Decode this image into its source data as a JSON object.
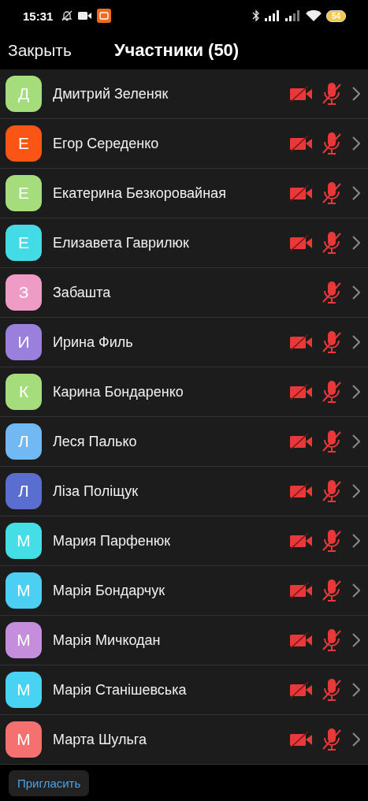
{
  "status_bar": {
    "time": "15:31",
    "battery": "54"
  },
  "header": {
    "close": "Закрыть",
    "title": "Участники (50)"
  },
  "participants": [
    {
      "initial": "Д",
      "name": "Дмитрий Зеленяк",
      "color": "#a6dd7c",
      "camera_off": true,
      "mic_muted": true
    },
    {
      "initial": "Е",
      "name": "Егор Середенко",
      "color": "#fa5514",
      "camera_off": true,
      "mic_muted": true
    },
    {
      "initial": "Е",
      "name": "Екатерина Безкоровайная",
      "color": "#a6dd7c",
      "camera_off": true,
      "mic_muted": true
    },
    {
      "initial": "Е",
      "name": "Елизавета Гаврилюк",
      "color": "#43dbe6",
      "camera_off": true,
      "mic_muted": true
    },
    {
      "initial": "З",
      "name": "Забашта",
      "color": "#ee9cc6",
      "camera_off": false,
      "mic_muted": true
    },
    {
      "initial": "И",
      "name": "Ирина Филь",
      "color": "#9a80dc",
      "camera_off": true,
      "mic_muted": true
    },
    {
      "initial": "К",
      "name": "Карина Бондаренко",
      "color": "#a6dd7c",
      "camera_off": true,
      "mic_muted": true
    },
    {
      "initial": "Л",
      "name": "Леся Палько",
      "color": "#72b9f4",
      "camera_off": true,
      "mic_muted": true
    },
    {
      "initial": "Л",
      "name": "Ліза Поліщук",
      "color": "#5a6ed0",
      "camera_off": true,
      "mic_muted": true
    },
    {
      "initial": "М",
      "name": "Мария Парфенюк",
      "color": "#43dee6",
      "camera_off": true,
      "mic_muted": true
    },
    {
      "initial": "М",
      "name": "Марія Бондарчук",
      "color": "#4dcff4",
      "camera_off": true,
      "mic_muted": true
    },
    {
      "initial": "М",
      "name": "Марія Мичкодан",
      "color": "#c48edc",
      "camera_off": true,
      "mic_muted": true
    },
    {
      "initial": "М",
      "name": "Марія Станішевська",
      "color": "#48d3f2",
      "camera_off": true,
      "mic_muted": true
    },
    {
      "initial": "М",
      "name": "Марта Шульга",
      "color": "#f4716f",
      "camera_off": true,
      "mic_muted": true
    }
  ],
  "footer": {
    "invite": "Пригласить"
  }
}
